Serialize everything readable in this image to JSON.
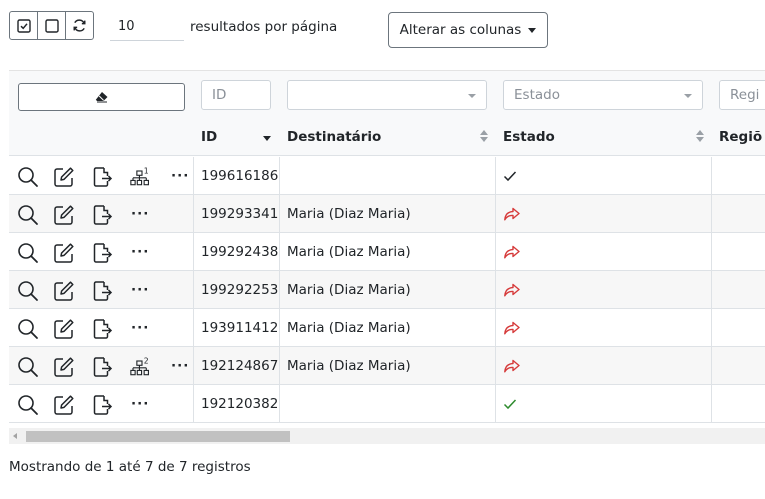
{
  "toolbar": {
    "select_all_icon": "checkbox-checked-icon",
    "select_none_icon": "checkbox-empty-icon",
    "refresh_icon": "refresh-icon",
    "per_page_value": "10",
    "per_page_label": "resultados por página",
    "columns_button_label": "Alterar as colunas"
  },
  "filters": {
    "clear_icon": "eraser-icon",
    "id_placeholder": "ID",
    "destinatario_value": "",
    "estado_placeholder": "Estado",
    "regiao_placeholder": "Regi"
  },
  "columns": {
    "id": "ID",
    "destinatario": "Destinatário",
    "estado": "Estado",
    "regiao": "Regiõ"
  },
  "colors": {
    "status_ok": "#212529",
    "status_ok_green": "#2e8b2e",
    "status_forwarded": "#d63a3a"
  },
  "rows": [
    {
      "id": "199616186",
      "destinatario": "",
      "estado_icon": "check-icon",
      "estado_color": "dark",
      "hierarchy": "1"
    },
    {
      "id": "199293341",
      "destinatario": "Maria (Diaz Maria)",
      "estado_icon": "share-arrow-icon",
      "estado_color": "red",
      "hierarchy": ""
    },
    {
      "id": "199292438",
      "destinatario": "Maria (Diaz Maria)",
      "estado_icon": "share-arrow-icon",
      "estado_color": "red",
      "hierarchy": ""
    },
    {
      "id": "199292253",
      "destinatario": "Maria (Diaz Maria)",
      "estado_icon": "share-arrow-icon",
      "estado_color": "red",
      "hierarchy": ""
    },
    {
      "id": "193911412",
      "destinatario": "Maria (Diaz Maria)",
      "estado_icon": "share-arrow-icon",
      "estado_color": "red",
      "hierarchy": ""
    },
    {
      "id": "192124867",
      "destinatario": "Maria (Diaz Maria)",
      "estado_icon": "share-arrow-icon",
      "estado_color": "red",
      "hierarchy": "2"
    },
    {
      "id": "192120382",
      "destinatario": "",
      "estado_icon": "check-icon",
      "estado_color": "green",
      "hierarchy": ""
    }
  ],
  "actions": {
    "more_label": "···",
    "icons": [
      "search-icon",
      "edit-icon",
      "file-export-icon",
      "hierarchy-icon"
    ]
  },
  "footer": {
    "summary": "Mostrando de 1 até 7 de 7 registros"
  }
}
